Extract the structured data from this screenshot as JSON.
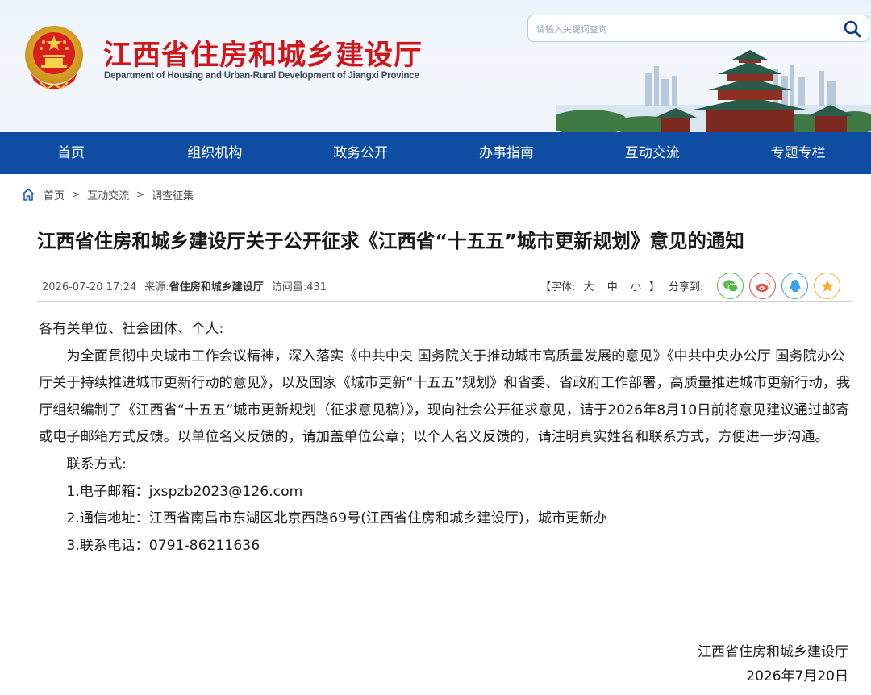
{
  "header": {
    "title": "江西省住房和城乡建设厅",
    "subtitle": "Department of Housing and Urban-Rural Development of Jiangxi Province",
    "search_placeholder": "请输入关键词查询",
    "colors": {
      "title_red": "#d0161b",
      "nav_blue": "#0e4da2"
    }
  },
  "nav": {
    "items": [
      {
        "label": "首页"
      },
      {
        "label": "组织机构"
      },
      {
        "label": "政务公开"
      },
      {
        "label": "办事指南"
      },
      {
        "label": "互动交流"
      },
      {
        "label": "专题专栏"
      }
    ]
  },
  "breadcrumb": {
    "icon": "home-icon",
    "items": [
      "首页",
      "互动交流",
      "调查征集"
    ],
    "separator": ">"
  },
  "article": {
    "title": "江西省住房和城乡建设厅关于公开征求《江西省“十五五”城市更新规划》意见的通知",
    "datetime": "2026-07-20 17:24",
    "source_label": "来源:",
    "source_value": "省住房和城乡建设厅",
    "views_label": "访问量:",
    "views_value": "431",
    "font_size_label": "【字体:",
    "font_sizes": [
      "大",
      "中",
      "小"
    ],
    "font_size_close": "】",
    "share_label": "分享到:",
    "share_icons": [
      "wechat-icon",
      "weibo-icon",
      "qq-icon",
      "qzone-icon"
    ],
    "greeting": "各有关单位、社会团体、个人:",
    "body": "为全面贯彻中央城市工作会议精神，深入落实《中共中央 国务院关于推动城市高质量发展的意见》《中共中央办公厅 国务院办公厅关于持续推进城市更新行动的意见》，以及国家《城市更新“十五五”规划》和省委、省政府工作部署，高质量推进城市更新行动，我厅组织编制了《江西省“十五五”城市更新规划（征求意见稿）》，现向社会公开征求意见，请于2026年8月10日前将意见建议通过邮寄或电子邮箱方式反馈。以单位名义反馈的，请加盖单位公章；以个人名义反馈的，请注明真实姓名和联系方式，方便进一步沟通。",
    "contact_heading": "联系方式:",
    "contacts": [
      "1.电子邮箱：jxspzb2023@126.com",
      "2.通信地址：江西省南昌市东湖区北京西路69号(江西省住房和城乡建设厅)，城市更新办",
      "3.联系电话：0791-86211636"
    ],
    "signature_org": "江西省住房和城乡建设厅",
    "signature_date": "2026年7月20日"
  }
}
